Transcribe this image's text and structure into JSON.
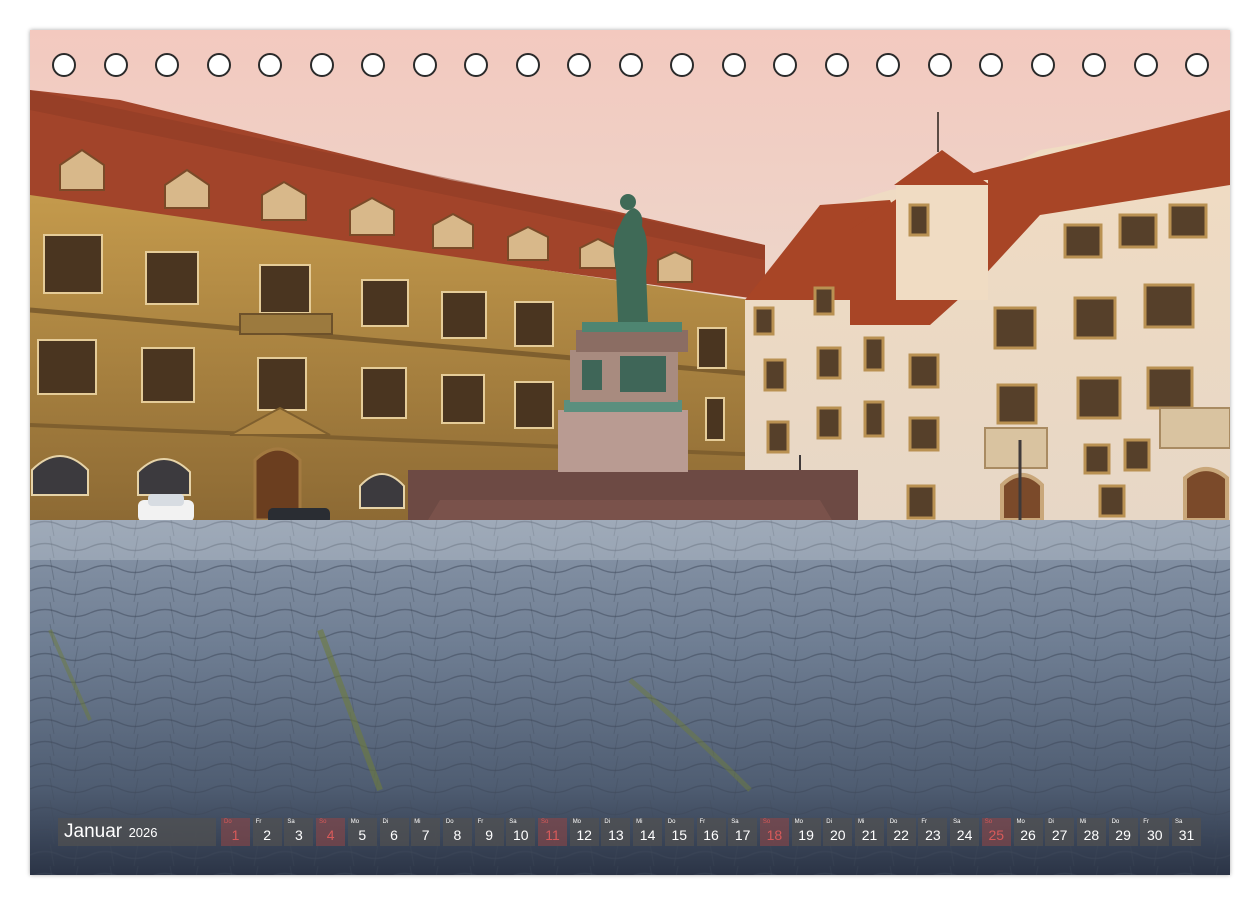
{
  "calendar": {
    "month": "Januar",
    "year": "2026",
    "days": [
      {
        "dow": "Do",
        "num": "1",
        "holiday": true
      },
      {
        "dow": "Fr",
        "num": "2",
        "holiday": false
      },
      {
        "dow": "Sa",
        "num": "3",
        "holiday": false
      },
      {
        "dow": "So",
        "num": "4",
        "holiday": true
      },
      {
        "dow": "Mo",
        "num": "5",
        "holiday": false
      },
      {
        "dow": "Di",
        "num": "6",
        "holiday": false
      },
      {
        "dow": "Mi",
        "num": "7",
        "holiday": false
      },
      {
        "dow": "Do",
        "num": "8",
        "holiday": false
      },
      {
        "dow": "Fr",
        "num": "9",
        "holiday": false
      },
      {
        "dow": "Sa",
        "num": "10",
        "holiday": false
      },
      {
        "dow": "So",
        "num": "11",
        "holiday": true
      },
      {
        "dow": "Mo",
        "num": "12",
        "holiday": false
      },
      {
        "dow": "Di",
        "num": "13",
        "holiday": false
      },
      {
        "dow": "Mi",
        "num": "14",
        "holiday": false
      },
      {
        "dow": "Do",
        "num": "15",
        "holiday": false
      },
      {
        "dow": "Fr",
        "num": "16",
        "holiday": false
      },
      {
        "dow": "Sa",
        "num": "17",
        "holiday": false
      },
      {
        "dow": "So",
        "num": "18",
        "holiday": true
      },
      {
        "dow": "Mo",
        "num": "19",
        "holiday": false
      },
      {
        "dow": "Di",
        "num": "20",
        "holiday": false
      },
      {
        "dow": "Mi",
        "num": "21",
        "holiday": false
      },
      {
        "dow": "Do",
        "num": "22",
        "holiday": false
      },
      {
        "dow": "Fr",
        "num": "23",
        "holiday": false
      },
      {
        "dow": "Sa",
        "num": "24",
        "holiday": false
      },
      {
        "dow": "So",
        "num": "25",
        "holiday": true
      },
      {
        "dow": "Mo",
        "num": "26",
        "holiday": false
      },
      {
        "dow": "Di",
        "num": "27",
        "holiday": false
      },
      {
        "dow": "Mi",
        "num": "28",
        "holiday": false
      },
      {
        "dow": "Do",
        "num": "29",
        "holiday": false
      },
      {
        "dow": "Fr",
        "num": "30",
        "holiday": false
      },
      {
        "dow": "Sa",
        "num": "31",
        "holiday": false
      }
    ]
  },
  "colors": {
    "roof": "#a2442a",
    "facade_left": "#b48c45",
    "facade_right": "#ecdcc7",
    "cobblestone": "#6f7f93",
    "sky": "#e9c6bd",
    "holiday_text": "#d85a5a"
  }
}
